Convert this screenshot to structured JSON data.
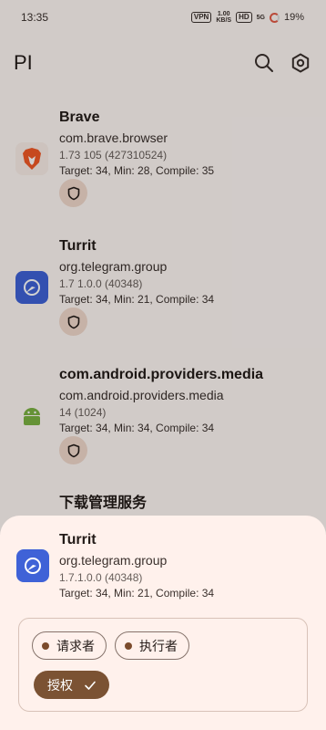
{
  "status": {
    "time": "13:35",
    "vpn": "VPN",
    "speed_top": "1.00",
    "speed_bottom": "KB/S",
    "hd": "HD",
    "signal": "5G",
    "battery": "19%"
  },
  "header": {
    "title": "PI"
  },
  "apps": [
    {
      "name": "Brave",
      "package": "com.brave.browser",
      "version": "1.73 105 (427310524)",
      "target": "Target: 34, Min: 28, Compile: 35",
      "icon": "brave-lion-icon"
    },
    {
      "name": "Turrit",
      "package": "org.telegram.group",
      "version": "1.7 1.0.0 (40348)",
      "target": "Target: 34, Min: 21, Compile: 34",
      "icon": "turrit-icon"
    },
    {
      "name": "com.android.providers.media",
      "package": "com.android.providers.media",
      "version": "14 (1024)",
      "target": "Target: 34, Min: 34, Compile: 34",
      "icon": "android-icon"
    },
    {
      "name": "下载管理服务"
    }
  ],
  "sheet": {
    "name": "Turrit",
    "package": "org.telegram.group",
    "version": "1.7.1.0.0 (40348)",
    "target": "Target: 34, Min: 21, Compile: 34",
    "chip_requester": "请求者",
    "chip_executor": "执行者",
    "grant_label": "授权"
  },
  "colors": {
    "accent": "#7b5233",
    "sheet_bg": "#fff1ec",
    "shield_bg": "#f2d9cc"
  }
}
